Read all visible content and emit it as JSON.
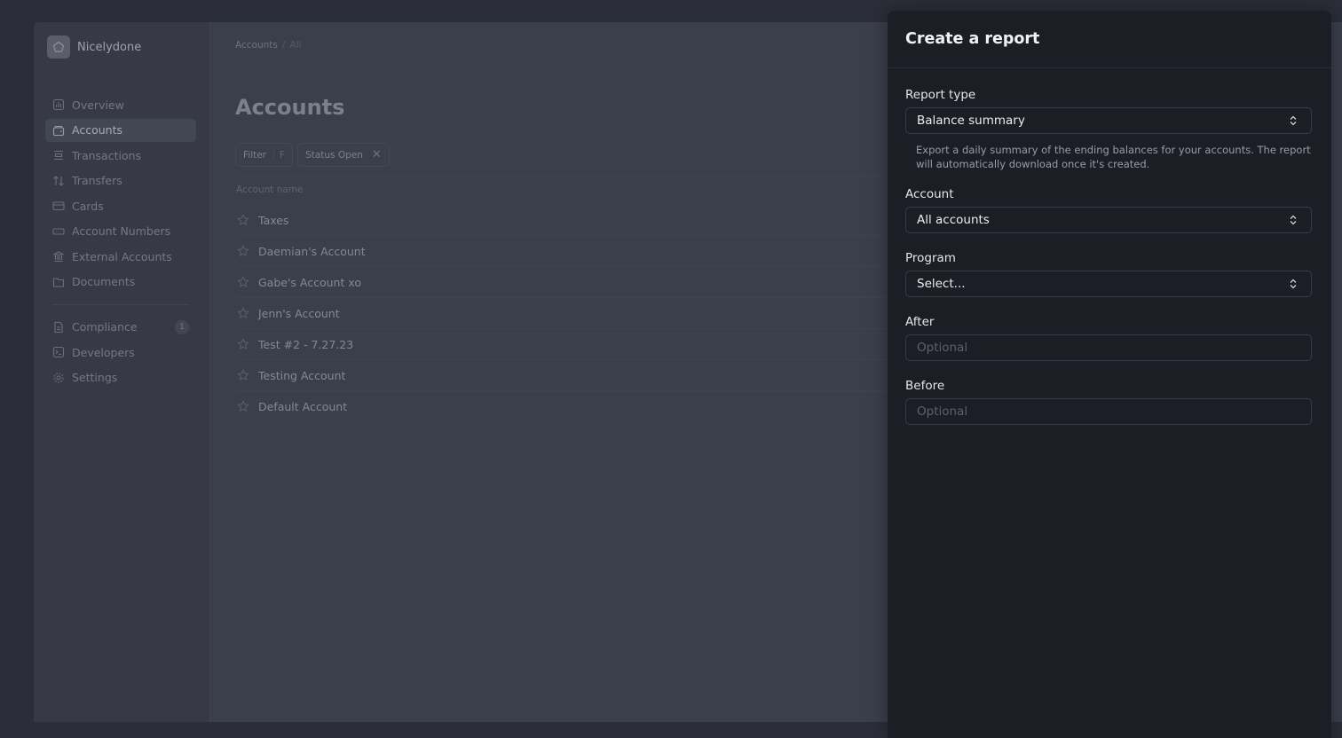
{
  "brand": {
    "name": "Nicelydone"
  },
  "sidebar": {
    "items": [
      {
        "label": "Overview",
        "icon": "chart-icon"
      },
      {
        "label": "Accounts",
        "icon": "wallet-icon",
        "active": true
      },
      {
        "label": "Transactions",
        "icon": "list-icon"
      },
      {
        "label": "Transfers",
        "icon": "arrows-icon"
      },
      {
        "label": "Cards",
        "icon": "card-icon"
      },
      {
        "label": "Account Numbers",
        "icon": "number-icon"
      },
      {
        "label": "External Accounts",
        "icon": "bank-icon"
      },
      {
        "label": "Documents",
        "icon": "folder-icon"
      }
    ],
    "secondary": [
      {
        "label": "Compliance",
        "icon": "document-icon",
        "badge": "1"
      },
      {
        "label": "Developers",
        "icon": "terminal-icon"
      },
      {
        "label": "Settings",
        "icon": "gear-icon"
      }
    ]
  },
  "main": {
    "breadcrumb": {
      "root": "Accounts",
      "separator": "/",
      "current": "All"
    },
    "title": "Accounts",
    "filters": {
      "filter_label": "Filter",
      "filter_key": "F",
      "status_chip": "Status Open"
    },
    "column_header": "Account name",
    "accounts": [
      "Taxes",
      "Daemian's Account",
      "Gabe's Account xo",
      "Jenn's Account",
      "Test #2 - 7.27.23",
      "Testing Account",
      "Default Account"
    ]
  },
  "panel": {
    "title": "Create a report",
    "report_type": {
      "label": "Report type",
      "value": "Balance summary",
      "help": "Export a daily summary of the ending balances for your accounts. The report will automatically download once it's created."
    },
    "account": {
      "label": "Account",
      "value": "All accounts"
    },
    "program": {
      "label": "Program",
      "value": "Select..."
    },
    "after": {
      "label": "After",
      "placeholder": "Optional"
    },
    "before": {
      "label": "Before",
      "placeholder": "Optional"
    }
  }
}
